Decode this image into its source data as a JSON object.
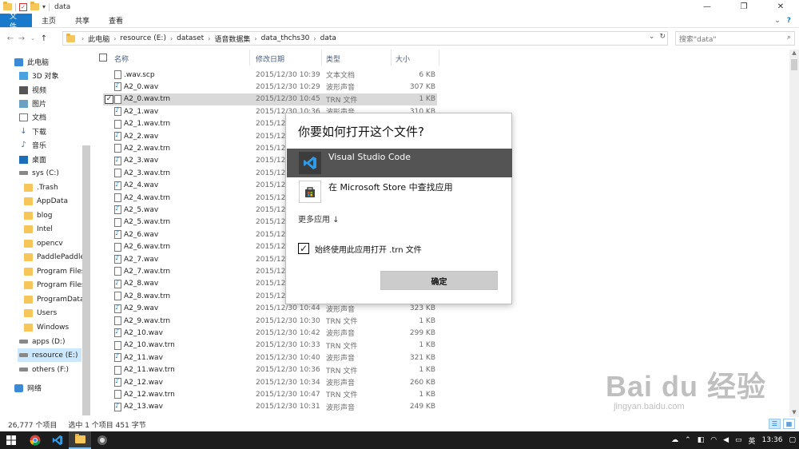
{
  "window": {
    "title": "data",
    "controls": {
      "minimize": "—",
      "restore": "❐",
      "close": "✕"
    }
  },
  "ribbon": {
    "tabs": [
      "文件",
      "主页",
      "共享",
      "查看"
    ]
  },
  "address": {
    "crumbs": [
      "此电脑",
      "resource (E:)",
      "dataset",
      "语音数据集",
      "data_thchs30",
      "data"
    ],
    "search_placeholder": "搜索\"data\""
  },
  "nav": {
    "items": [
      {
        "label": "此电脑",
        "icon": "computer-icon"
      },
      {
        "label": "3D 对象",
        "icon": "3d-objects-icon"
      },
      {
        "label": "视频",
        "icon": "video-icon"
      },
      {
        "label": "图片",
        "icon": "pictures-icon"
      },
      {
        "label": "文档",
        "icon": "documents-icon"
      },
      {
        "label": "下载",
        "icon": "download-icon"
      },
      {
        "label": "音乐",
        "icon": "music-icon"
      },
      {
        "label": "桌面",
        "icon": "desktop-icon"
      },
      {
        "label": "sys (C:)",
        "icon": "drive-icon"
      },
      {
        "label": ".Trash",
        "icon": "folder-icon"
      },
      {
        "label": "AppData",
        "icon": "folder-icon"
      },
      {
        "label": "blog",
        "icon": "folder-icon"
      },
      {
        "label": "Intel",
        "icon": "folder-icon"
      },
      {
        "label": "opencv",
        "icon": "folder-icon"
      },
      {
        "label": "PaddlePaddle",
        "icon": "folder-icon"
      },
      {
        "label": "Program Files",
        "icon": "folder-icon"
      },
      {
        "label": "Program Files",
        "icon": "folder-icon"
      },
      {
        "label": "ProgramData",
        "icon": "folder-icon"
      },
      {
        "label": "Users",
        "icon": "folder-icon"
      },
      {
        "label": "Windows",
        "icon": "folder-icon"
      },
      {
        "label": "apps (D:)",
        "icon": "drive-icon"
      },
      {
        "label": "resource (E:)",
        "icon": "drive-icon"
      },
      {
        "label": "others (F:)",
        "icon": "drive-icon"
      },
      {
        "label": "网络",
        "icon": "network-icon"
      }
    ]
  },
  "columns": {
    "name": "名称",
    "date": "修改日期",
    "type": "类型",
    "size": "大小"
  },
  "files": [
    {
      "name": ".wav.scp",
      "date": "2015/12/30 10:39",
      "type": "文本文档",
      "size": "6 KB",
      "kind": "doc"
    },
    {
      "name": "A2_0.wav",
      "date": "2015/12/30 10:29",
      "type": "波形声音",
      "size": "307 KB",
      "kind": "wav"
    },
    {
      "name": "A2_0.wav.trn",
      "date": "2015/12/30 10:45",
      "type": "TRN 文件",
      "size": "1 KB",
      "kind": "doc",
      "selected": true
    },
    {
      "name": "A2_1.wav",
      "date": "2015/12/30 10:36",
      "type": "波形声音",
      "size": "310 KB",
      "kind": "wav"
    },
    {
      "name": "A2_1.wav.trn",
      "date": "2015/12",
      "type": "",
      "size": "",
      "kind": "doc"
    },
    {
      "name": "A2_2.wav",
      "date": "2015/12",
      "type": "",
      "size": "",
      "kind": "wav"
    },
    {
      "name": "A2_2.wav.trn",
      "date": "2015/12",
      "type": "",
      "size": "",
      "kind": "doc"
    },
    {
      "name": "A2_3.wav",
      "date": "2015/12",
      "type": "",
      "size": "",
      "kind": "wav"
    },
    {
      "name": "A2_3.wav.trn",
      "date": "2015/12",
      "type": "",
      "size": "",
      "kind": "doc"
    },
    {
      "name": "A2_4.wav",
      "date": "2015/12",
      "type": "",
      "size": "",
      "kind": "wav"
    },
    {
      "name": "A2_4.wav.trn",
      "date": "2015/12",
      "type": "",
      "size": "",
      "kind": "doc"
    },
    {
      "name": "A2_5.wav",
      "date": "2015/12",
      "type": "",
      "size": "",
      "kind": "wav"
    },
    {
      "name": "A2_5.wav.trn",
      "date": "2015/12",
      "type": "",
      "size": "",
      "kind": "doc"
    },
    {
      "name": "A2_6.wav",
      "date": "2015/12",
      "type": "",
      "size": "",
      "kind": "wav"
    },
    {
      "name": "A2_6.wav.trn",
      "date": "2015/12",
      "type": "",
      "size": "",
      "kind": "doc"
    },
    {
      "name": "A2_7.wav",
      "date": "2015/12",
      "type": "",
      "size": "",
      "kind": "wav"
    },
    {
      "name": "A2_7.wav.trn",
      "date": "2015/12",
      "type": "",
      "size": "",
      "kind": "doc"
    },
    {
      "name": "A2_8.wav",
      "date": "2015/12",
      "type": "",
      "size": "",
      "kind": "wav"
    },
    {
      "name": "A2_8.wav.trn",
      "date": "2015/12",
      "type": "",
      "size": "",
      "kind": "doc"
    },
    {
      "name": "A2_9.wav",
      "date": "2015/12/30 10:44",
      "type": "波形声音",
      "size": "323 KB",
      "kind": "wav"
    },
    {
      "name": "A2_9.wav.trn",
      "date": "2015/12/30 10:30",
      "type": "TRN 文件",
      "size": "1 KB",
      "kind": "doc"
    },
    {
      "name": "A2_10.wav",
      "date": "2015/12/30 10:42",
      "type": "波形声音",
      "size": "299 KB",
      "kind": "wav"
    },
    {
      "name": "A2_10.wav.trn",
      "date": "2015/12/30 10:33",
      "type": "TRN 文件",
      "size": "1 KB",
      "kind": "doc"
    },
    {
      "name": "A2_11.wav",
      "date": "2015/12/30 10:40",
      "type": "波形声音",
      "size": "321 KB",
      "kind": "wav"
    },
    {
      "name": "A2_11.wav.trn",
      "date": "2015/12/30 10:36",
      "type": "TRN 文件",
      "size": "1 KB",
      "kind": "doc"
    },
    {
      "name": "A2_12.wav",
      "date": "2015/12/30 10:34",
      "type": "波形声音",
      "size": "260 KB",
      "kind": "wav"
    },
    {
      "name": "A2_12.wav.trn",
      "date": "2015/12/30 10:47",
      "type": "TRN 文件",
      "size": "1 KB",
      "kind": "doc"
    },
    {
      "name": "A2_13.wav",
      "date": "2015/12/30 10:31",
      "type": "波形声音",
      "size": "249 KB",
      "kind": "wav"
    }
  ],
  "dialog": {
    "title": "你要如何打开这个文件?",
    "options": [
      {
        "label": "Visual Studio Code",
        "icon": "vscode-icon",
        "selected": true
      },
      {
        "label": "在 Microsoft Store 中查找应用",
        "icon": "store-icon",
        "selected": false
      }
    ],
    "more_apps": "更多应用 ↓",
    "always_use": "始终使用此应用打开 .trn 文件",
    "always_use_checked": true,
    "ok": "确定"
  },
  "status": {
    "item_count": "26,777 个项目",
    "selection": "选中 1 个项目  451 字节"
  },
  "taskbar": {
    "time": "13:36",
    "ime": "英"
  },
  "watermark": {
    "brand": "Bai du 经验",
    "url": "jingyan.baidu.com"
  },
  "colors": {
    "accent": "#1979ca",
    "selected_row": "#d9d9d9",
    "dialog_selected": "#545454"
  }
}
